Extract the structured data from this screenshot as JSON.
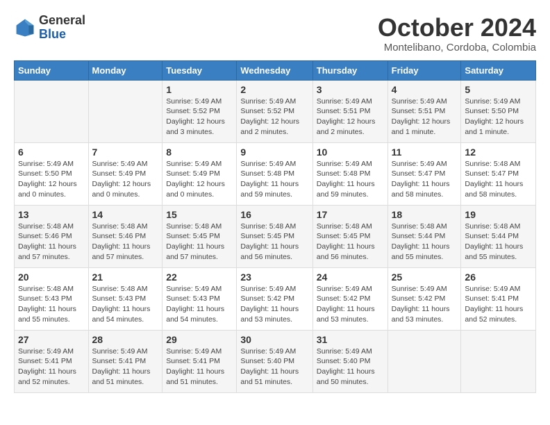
{
  "logo": {
    "general": "General",
    "blue": "Blue"
  },
  "title": "October 2024",
  "location": "Montelibano, Cordoba, Colombia",
  "days_header": [
    "Sunday",
    "Monday",
    "Tuesday",
    "Wednesday",
    "Thursday",
    "Friday",
    "Saturday"
  ],
  "weeks": [
    [
      {
        "day": "",
        "details": ""
      },
      {
        "day": "",
        "details": ""
      },
      {
        "day": "1",
        "details": "Sunrise: 5:49 AM\nSunset: 5:52 PM\nDaylight: 12 hours\nand 3 minutes."
      },
      {
        "day": "2",
        "details": "Sunrise: 5:49 AM\nSunset: 5:52 PM\nDaylight: 12 hours\nand 2 minutes."
      },
      {
        "day": "3",
        "details": "Sunrise: 5:49 AM\nSunset: 5:51 PM\nDaylight: 12 hours\nand 2 minutes."
      },
      {
        "day": "4",
        "details": "Sunrise: 5:49 AM\nSunset: 5:51 PM\nDaylight: 12 hours\nand 1 minute."
      },
      {
        "day": "5",
        "details": "Sunrise: 5:49 AM\nSunset: 5:50 PM\nDaylight: 12 hours\nand 1 minute."
      }
    ],
    [
      {
        "day": "6",
        "details": "Sunrise: 5:49 AM\nSunset: 5:50 PM\nDaylight: 12 hours\nand 0 minutes."
      },
      {
        "day": "7",
        "details": "Sunrise: 5:49 AM\nSunset: 5:49 PM\nDaylight: 12 hours\nand 0 minutes."
      },
      {
        "day": "8",
        "details": "Sunrise: 5:49 AM\nSunset: 5:49 PM\nDaylight: 12 hours\nand 0 minutes."
      },
      {
        "day": "9",
        "details": "Sunrise: 5:49 AM\nSunset: 5:48 PM\nDaylight: 11 hours\nand 59 minutes."
      },
      {
        "day": "10",
        "details": "Sunrise: 5:49 AM\nSunset: 5:48 PM\nDaylight: 11 hours\nand 59 minutes."
      },
      {
        "day": "11",
        "details": "Sunrise: 5:49 AM\nSunset: 5:47 PM\nDaylight: 11 hours\nand 58 minutes."
      },
      {
        "day": "12",
        "details": "Sunrise: 5:48 AM\nSunset: 5:47 PM\nDaylight: 11 hours\nand 58 minutes."
      }
    ],
    [
      {
        "day": "13",
        "details": "Sunrise: 5:48 AM\nSunset: 5:46 PM\nDaylight: 11 hours\nand 57 minutes."
      },
      {
        "day": "14",
        "details": "Sunrise: 5:48 AM\nSunset: 5:46 PM\nDaylight: 11 hours\nand 57 minutes."
      },
      {
        "day": "15",
        "details": "Sunrise: 5:48 AM\nSunset: 5:45 PM\nDaylight: 11 hours\nand 57 minutes."
      },
      {
        "day": "16",
        "details": "Sunrise: 5:48 AM\nSunset: 5:45 PM\nDaylight: 11 hours\nand 56 minutes."
      },
      {
        "day": "17",
        "details": "Sunrise: 5:48 AM\nSunset: 5:45 PM\nDaylight: 11 hours\nand 56 minutes."
      },
      {
        "day": "18",
        "details": "Sunrise: 5:48 AM\nSunset: 5:44 PM\nDaylight: 11 hours\nand 55 minutes."
      },
      {
        "day": "19",
        "details": "Sunrise: 5:48 AM\nSunset: 5:44 PM\nDaylight: 11 hours\nand 55 minutes."
      }
    ],
    [
      {
        "day": "20",
        "details": "Sunrise: 5:48 AM\nSunset: 5:43 PM\nDaylight: 11 hours\nand 55 minutes."
      },
      {
        "day": "21",
        "details": "Sunrise: 5:48 AM\nSunset: 5:43 PM\nDaylight: 11 hours\nand 54 minutes."
      },
      {
        "day": "22",
        "details": "Sunrise: 5:49 AM\nSunset: 5:43 PM\nDaylight: 11 hours\nand 54 minutes."
      },
      {
        "day": "23",
        "details": "Sunrise: 5:49 AM\nSunset: 5:42 PM\nDaylight: 11 hours\nand 53 minutes."
      },
      {
        "day": "24",
        "details": "Sunrise: 5:49 AM\nSunset: 5:42 PM\nDaylight: 11 hours\nand 53 minutes."
      },
      {
        "day": "25",
        "details": "Sunrise: 5:49 AM\nSunset: 5:42 PM\nDaylight: 11 hours\nand 53 minutes."
      },
      {
        "day": "26",
        "details": "Sunrise: 5:49 AM\nSunset: 5:41 PM\nDaylight: 11 hours\nand 52 minutes."
      }
    ],
    [
      {
        "day": "27",
        "details": "Sunrise: 5:49 AM\nSunset: 5:41 PM\nDaylight: 11 hours\nand 52 minutes."
      },
      {
        "day": "28",
        "details": "Sunrise: 5:49 AM\nSunset: 5:41 PM\nDaylight: 11 hours\nand 51 minutes."
      },
      {
        "day": "29",
        "details": "Sunrise: 5:49 AM\nSunset: 5:41 PM\nDaylight: 11 hours\nand 51 minutes."
      },
      {
        "day": "30",
        "details": "Sunrise: 5:49 AM\nSunset: 5:40 PM\nDaylight: 11 hours\nand 51 minutes."
      },
      {
        "day": "31",
        "details": "Sunrise: 5:49 AM\nSunset: 5:40 PM\nDaylight: 11 hours\nand 50 minutes."
      },
      {
        "day": "",
        "details": ""
      },
      {
        "day": "",
        "details": ""
      }
    ]
  ]
}
